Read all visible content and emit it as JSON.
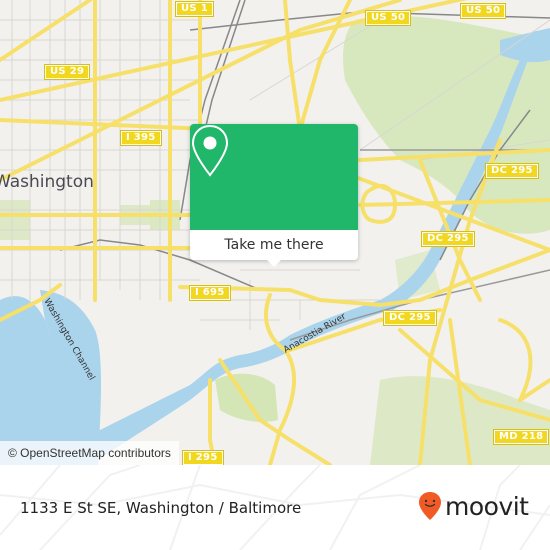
{
  "map": {
    "city_label": "Washington",
    "water_labels": {
      "washington_channel": "Washington Channel",
      "anacostia_river": "Anacostia River"
    },
    "route_shields": [
      {
        "id": "us1",
        "label": "US 1"
      },
      {
        "id": "us50a",
        "label": "US 50"
      },
      {
        "id": "us50b",
        "label": "US 50"
      },
      {
        "id": "us29",
        "label": "US 29"
      },
      {
        "id": "i395",
        "label": "I 395"
      },
      {
        "id": "dc295a",
        "label": "DC 295"
      },
      {
        "id": "dc295b",
        "label": "DC 295"
      },
      {
        "id": "dc295c",
        "label": "DC 295"
      },
      {
        "id": "i695",
        "label": "I 695"
      },
      {
        "id": "i295",
        "label": "I 295"
      },
      {
        "id": "md218",
        "label": "MD 218"
      }
    ],
    "attribution": "© OpenStreetMap contributors",
    "colors": {
      "land": "#f2f1ee",
      "park": "#d4e6b5",
      "water": "#aad3ec",
      "road": "#f6e06a",
      "shield": "#f1d71f"
    }
  },
  "popup": {
    "icon": "location-pin-icon",
    "button_label": "Take me there",
    "accent_color": "#21b76a"
  },
  "footer": {
    "address": "1133 E St SE, Washington / Baltimore",
    "brand": "moovit",
    "brand_color": "#f15a24"
  }
}
